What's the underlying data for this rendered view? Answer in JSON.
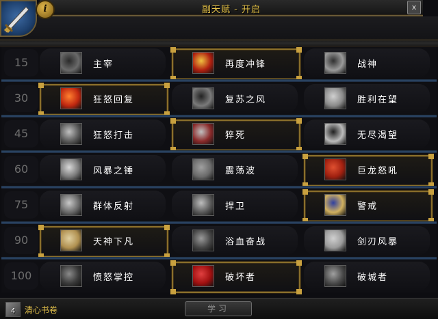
{
  "window": {
    "title": "副天赋 - 开启",
    "close_label": "x"
  },
  "info_button": {
    "label": "i"
  },
  "rows": [
    {
      "level": "15",
      "talents": [
        {
          "name": "主宰",
          "icon": "warrior-face-icon",
          "selected": false
        },
        {
          "name": "再度冲锋",
          "icon": "double-charge-icon",
          "selected": true
        },
        {
          "name": "战神",
          "icon": "warbringer-icon",
          "selected": false
        }
      ]
    },
    {
      "level": "30",
      "talents": [
        {
          "name": "狂怒回复",
          "icon": "enraged-regeneration-icon",
          "selected": true
        },
        {
          "name": "复苏之风",
          "icon": "second-wind-icon",
          "selected": false
        },
        {
          "name": "胜利在望",
          "icon": "impending-victory-icon",
          "selected": false
        }
      ]
    },
    {
      "level": "45",
      "talents": [
        {
          "name": "狂怒打击",
          "icon": "furious-strikes-icon",
          "selected": false
        },
        {
          "name": "猝死",
          "icon": "sudden-death-icon",
          "selected": true
        },
        {
          "name": "无尽渴望",
          "icon": "unquenchable-thirst-icon",
          "selected": false
        }
      ]
    },
    {
      "level": "60",
      "talents": [
        {
          "name": "风暴之锤",
          "icon": "storm-bolt-icon",
          "selected": false
        },
        {
          "name": "震荡波",
          "icon": "shockwave-icon",
          "selected": false
        },
        {
          "name": "巨龙怒吼",
          "icon": "dragon-roar-icon",
          "selected": true
        }
      ]
    },
    {
      "level": "75",
      "talents": [
        {
          "name": "群体反射",
          "icon": "mass-spell-reflection-icon",
          "selected": false
        },
        {
          "name": "捍卫",
          "icon": "safeguard-icon",
          "selected": false
        },
        {
          "name": "警戒",
          "icon": "vigilance-icon",
          "selected": true
        }
      ]
    },
    {
      "level": "90",
      "talents": [
        {
          "name": "天神下凡",
          "icon": "avatar-icon",
          "selected": true
        },
        {
          "name": "浴血奋战",
          "icon": "bloodbath-icon",
          "selected": false
        },
        {
          "name": "剑刃风暴",
          "icon": "bladestorm-icon",
          "selected": false
        }
      ]
    },
    {
      "level": "100",
      "talents": [
        {
          "name": "愤怒掌控",
          "icon": "anger-management-icon",
          "selected": false
        },
        {
          "name": "破坏者",
          "icon": "ravager-icon",
          "selected": true
        },
        {
          "name": "破城者",
          "icon": "siegebreaker-icon",
          "selected": false
        }
      ]
    }
  ],
  "footer": {
    "reagent_count": "4",
    "reagent_label": "清心书卷",
    "learn_label": "学习"
  },
  "colors": {
    "accent_gold": "#e9c64a",
    "selected_border": "#8a6f2b",
    "row_separator": "#2d4a6e"
  }
}
